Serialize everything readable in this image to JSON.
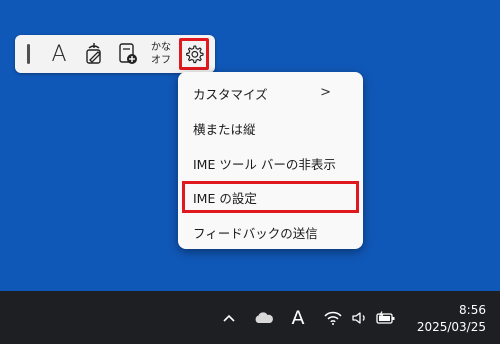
{
  "ime_toolbar": {
    "input_mode_label": "A",
    "kana_line1": "かな",
    "kana_line2": "オフ"
  },
  "context_menu": {
    "items": [
      {
        "label": "カスタマイズ",
        "has_submenu": true
      },
      {
        "label": "横または縦"
      },
      {
        "label": "IME ツール バーの非表示"
      },
      {
        "label": "IME の設定",
        "highlighted": true
      },
      {
        "label": "フィードバックの送信"
      }
    ],
    "submenu_chevron": ">"
  },
  "taskbar": {
    "input_indicator": "A",
    "time": "8:56",
    "date": "2025/03/25"
  },
  "colors": {
    "desktop": "#1058b8",
    "highlight": "#e0191e",
    "taskbar": "#1d1f22"
  }
}
